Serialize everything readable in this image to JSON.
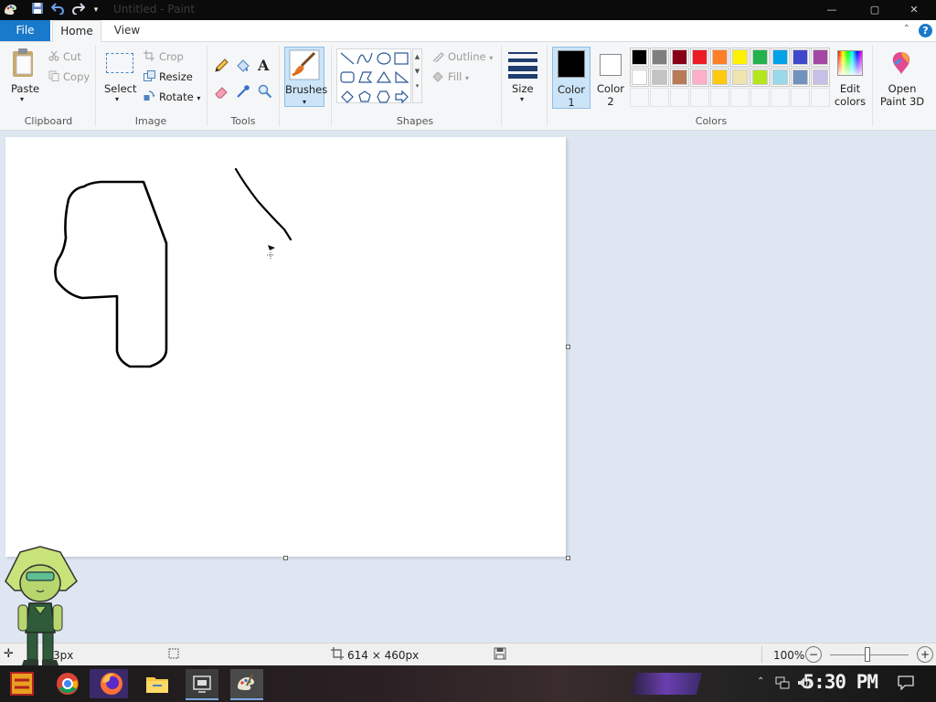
{
  "titlebar": {
    "title": "Untitled - Paint",
    "minimize": "—",
    "maximize": "▢",
    "close": "✕"
  },
  "tabs": {
    "file": "File",
    "home": "Home",
    "view": "View",
    "help": "?"
  },
  "clipboard": {
    "paste": "Paste",
    "cut": "Cut",
    "copy": "Copy",
    "group": "Clipboard"
  },
  "image": {
    "select": "Select",
    "crop": "Crop",
    "resize": "Resize",
    "rotate": "Rotate",
    "group": "Image"
  },
  "tools": {
    "group": "Tools"
  },
  "brushes": {
    "label": "Brushes"
  },
  "shapes": {
    "outline": "Outline",
    "fill": "Fill",
    "group": "Shapes"
  },
  "size": {
    "label": "Size"
  },
  "colors": {
    "color1_line1": "Color",
    "color1_line2": "1",
    "color2_line1": "Color",
    "color2_line2": "2",
    "edit_line1": "Edit",
    "edit_line2": "colors",
    "group": "Colors",
    "color1_value": "#000000",
    "color2_value": "#ffffff",
    "palette_row1": [
      "#000000",
      "#7f7f7f",
      "#880015",
      "#ed1c24",
      "#ff7f27",
      "#fff200",
      "#22b14c",
      "#00a2e8",
      "#3f48cc",
      "#a349a4"
    ],
    "palette_row2": [
      "#ffffff",
      "#c3c3c3",
      "#b97a57",
      "#ffaec9",
      "#ffc90e",
      "#efe4b0",
      "#b5e61d",
      "#99d9ea",
      "#7092be",
      "#c8bfe7"
    ]
  },
  "paint3d": {
    "line1": "Open",
    "line2": "Paint 3D"
  },
  "status": {
    "position": "3px",
    "canvas_size": "614 × 460px",
    "zoom": "100%"
  },
  "taskbar": {
    "time": "5:30 PM"
  },
  "icons": {
    "undo": "undo-icon",
    "redo": "redo-icon",
    "save": "save-icon",
    "paste": "paste-icon",
    "cut": "scissors-icon",
    "copy": "copy-icon",
    "crop": "crop-icon",
    "resize": "resize-icon",
    "rotate": "rotate-icon",
    "pencil": "pencil-icon",
    "fill": "fill-bucket-icon",
    "text": "text-icon",
    "eraser": "eraser-icon",
    "picker": "color-picker-icon",
    "magnifier": "magnifier-icon"
  }
}
